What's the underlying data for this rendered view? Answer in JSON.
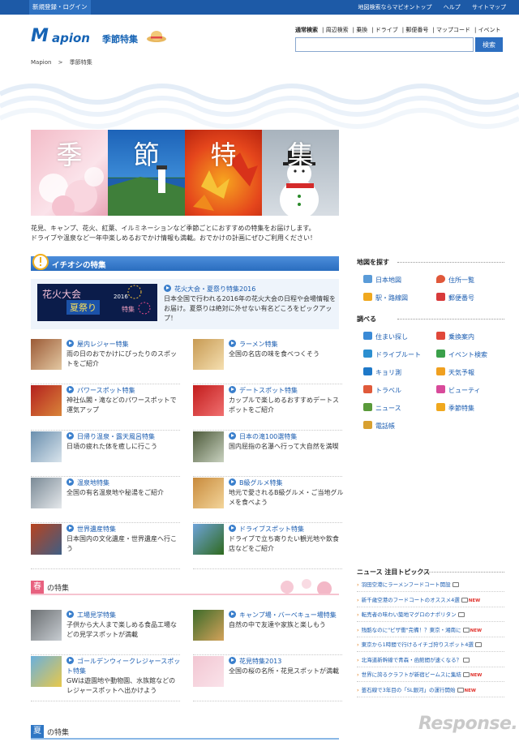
{
  "topbar": {
    "login": "新規登録・ログイン",
    "links": [
      "地図検索ならマピオントップ",
      "ヘルプ",
      "サイトマップ"
    ]
  },
  "logo": {
    "text_m": "M",
    "text_rest": "apion",
    "subtitle": "季節特集"
  },
  "nav_links": [
    "通常検索",
    "周辺検索",
    "乗換",
    "ドライブ",
    "郵便番号",
    "マップコード",
    "イベント"
  ],
  "search": {
    "button": "検索",
    "value": ""
  },
  "breadcrumb": {
    "home": "Mapion",
    "sep": ">",
    "current": "季節特集"
  },
  "hero": {
    "kanji": [
      "季",
      "節",
      "特",
      "集"
    ]
  },
  "intro": {
    "line1": "花見、キャンプ、花火、紅葉、イルミネーションなど季節ごとにおすすめの特集をお届けします。",
    "line2": "ドライブや温泉など一年中楽しめるおでかけ情報も満載。おでかけの計画にぜひご利用ください！"
  },
  "pickup": {
    "title": "イチオシの特集",
    "featured": {
      "banner_l1": "花火大会",
      "banner_l2": "夏祭り",
      "banner_year": "2016",
      "banner_tag": "特集",
      "title": "花火大会・夏祭り特集2016",
      "desc": "日本全国で行われる2016年の花火大会の日程や会場情報をお届け。夏祭りは絶対に外せない有名どころをピックアップ！"
    },
    "items": [
      {
        "title": "屋内レジャー特集",
        "desc": "雨の日のおでかけにぴったりのスポットをご紹介"
      },
      {
        "title": "ラーメン特集",
        "desc": "全国の名店の味を食べつくそう"
      },
      {
        "title": "パワースポット特集",
        "desc": "神社仏閣・滝などのパワースポットで運気アップ"
      },
      {
        "title": "デートスポット特集",
        "desc": "カップルで楽しめるおすすめデートスポットをご紹介"
      },
      {
        "title": "日帰り温泉・露天風呂特集",
        "desc": "日頃の疲れた体を癒しに行こう"
      },
      {
        "title": "日本の滝100選特集",
        "desc": "国内屈指の名瀑へ行って大自然を満喫"
      },
      {
        "title": "温泉地特集",
        "desc": "全国の有名温泉地や秘湯をご紹介"
      },
      {
        "title": "B級グルメ特集",
        "desc": "地元で愛されるB級グルメ・ご当地グルメを食べよう"
      },
      {
        "title": "世界遺産特集",
        "desc": "日本国内の文化遺産・世界遺産へ行こう"
      },
      {
        "title": "ドライブスポット特集",
        "desc": "ドライブで立ち寄りたい観光地や飲食店などをご紹介"
      }
    ]
  },
  "spring": {
    "kanji": "春",
    "title": "の特集",
    "items": [
      {
        "title": "工場見学特集",
        "desc": "子供から大人まで楽しめる食品工場などの見学スポットが満載"
      },
      {
        "title": "キャンプ場・バーベキュー場特集",
        "desc": "自然の中で友達や家族と楽しもう"
      },
      {
        "title": "ゴールデンウィークレジャースポット特集",
        "desc": "GWは遊園地や動物園、水族館などのレジャースポットへ出かけよう"
      },
      {
        "title": "花見特集2013",
        "desc": "全国の桜の名所・花見スポットが満載"
      }
    ]
  },
  "summer": {
    "kanji": "夏",
    "title": "の特集"
  },
  "sidebar": {
    "map_title": "地図を探す",
    "map_links": [
      "日本地図",
      "住所一覧",
      "駅・路線図",
      "郵便番号"
    ],
    "search_title": "調べる",
    "search_links": [
      "住まい探し",
      "乗換案内",
      "ドライブルート",
      "イベント検索",
      "キョリ測",
      "天気予報",
      "トラベル",
      "ビューティ",
      "ニュース",
      "季節特集",
      "電話帳"
    ]
  },
  "news": {
    "title": "ニュース 注目トピックス",
    "items": [
      {
        "text": "羽田空港にラーメンフードコート開設",
        "new": false
      },
      {
        "text": "新千歳空港のフードコートのオススメ4選",
        "new": true
      },
      {
        "text": "転売者の味わい築地マグロのナポリタン",
        "new": false
      },
      {
        "text": "残酷なのに\"ピザ衝\"完備！？東京・湘南に",
        "new": true
      },
      {
        "text": "東京から1時間で行けるイチゴ狩りスポット4選",
        "new": false
      },
      {
        "text": "北海道新幹線で青森・函館間が速くなる？",
        "new": false
      },
      {
        "text": "世界に誇るクラフトが新宿ビームスに集結",
        "new": true
      },
      {
        "text": "釜石線で3年目の「SL銀河」の運行開始",
        "new": true
      }
    ],
    "new_label": "NEW"
  },
  "watermark": "Response."
}
